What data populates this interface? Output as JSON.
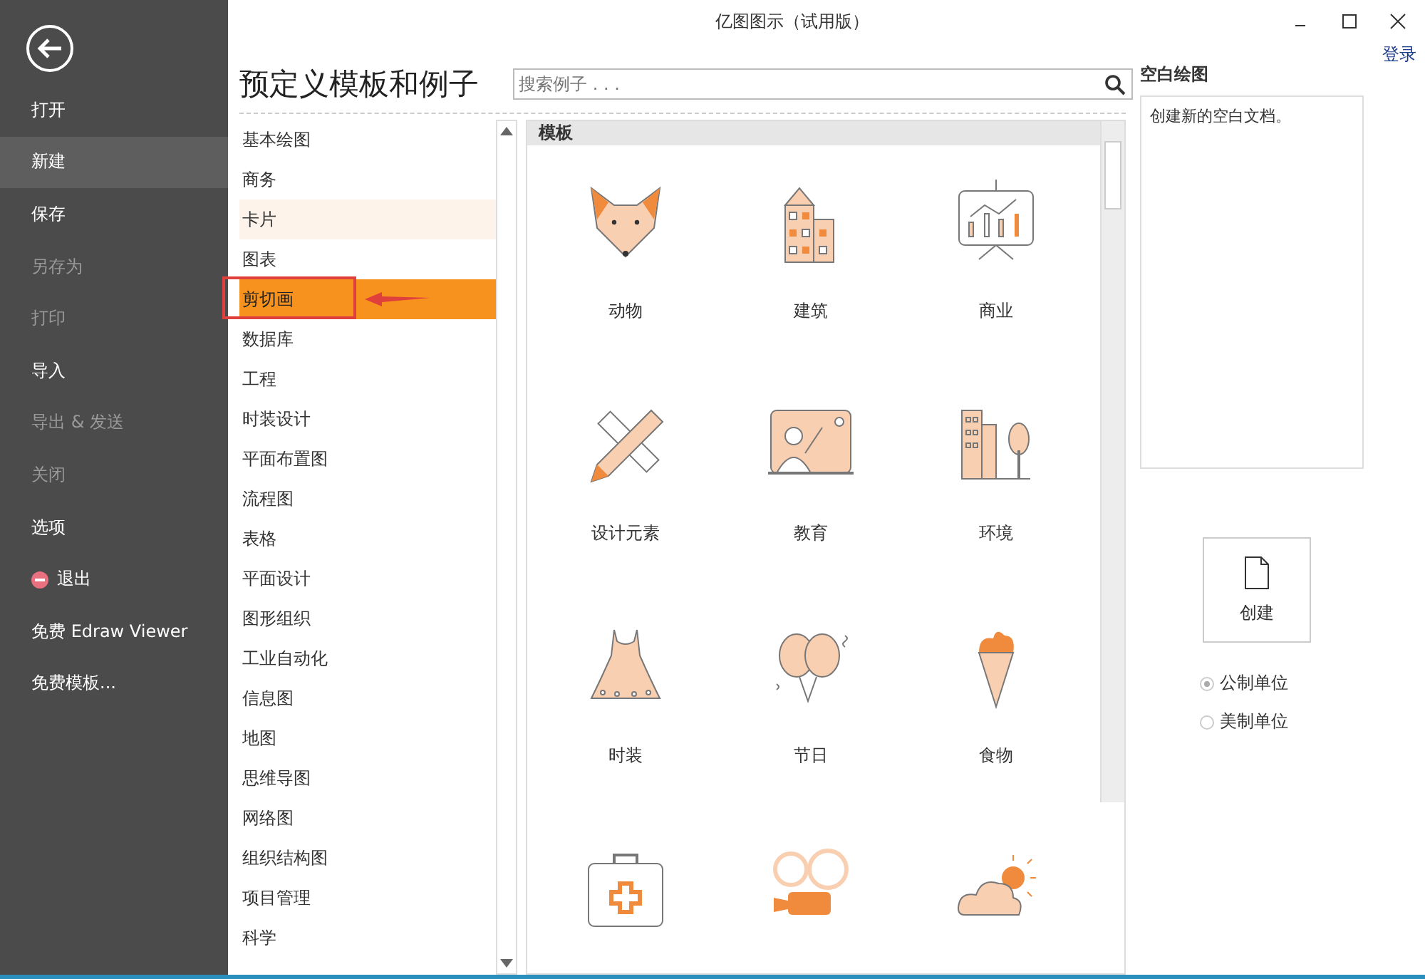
{
  "window": {
    "title": "亿图图示（试用版）",
    "login_link": "登录"
  },
  "sidebar": {
    "items": [
      {
        "label": "打开",
        "selected": false,
        "disabled": false,
        "kind": "text"
      },
      {
        "label": "新建",
        "selected": true,
        "disabled": false,
        "kind": "text"
      },
      {
        "label": "保存",
        "selected": false,
        "disabled": false,
        "kind": "text"
      },
      {
        "label": "另存为",
        "selected": false,
        "disabled": true,
        "kind": "text"
      },
      {
        "label": "打印",
        "selected": false,
        "disabled": true,
        "kind": "text"
      },
      {
        "label": "导入",
        "selected": false,
        "disabled": false,
        "kind": "text"
      },
      {
        "label": "导出 & 发送",
        "selected": false,
        "disabled": true,
        "kind": "text"
      },
      {
        "label": "关闭",
        "selected": false,
        "disabled": true,
        "kind": "text"
      },
      {
        "label": "选项",
        "selected": false,
        "disabled": false,
        "kind": "text"
      },
      {
        "label": "退出",
        "selected": false,
        "disabled": false,
        "kind": "exit"
      },
      {
        "label": "免费 Edraw Viewer",
        "selected": false,
        "disabled": false,
        "kind": "text"
      },
      {
        "label": "免费模板...",
        "selected": false,
        "disabled": false,
        "kind": "text"
      }
    ]
  },
  "heading": "预定义模板和例子",
  "search": {
    "placeholder": "搜索例子 . . ."
  },
  "categories": [
    {
      "label": "基本绘图",
      "selected": false,
      "hovered": false,
      "annotated": false
    },
    {
      "label": "商务",
      "selected": false,
      "hovered": false,
      "annotated": false
    },
    {
      "label": "卡片",
      "selected": false,
      "hovered": true,
      "annotated": false
    },
    {
      "label": "图表",
      "selected": false,
      "hovered": false,
      "annotated": false
    },
    {
      "label": "剪切画",
      "selected": true,
      "hovered": false,
      "annotated": true
    },
    {
      "label": "数据库",
      "selected": false,
      "hovered": false,
      "annotated": false
    },
    {
      "label": "工程",
      "selected": false,
      "hovered": false,
      "annotated": false
    },
    {
      "label": "时装设计",
      "selected": false,
      "hovered": false,
      "annotated": false
    },
    {
      "label": "平面布置图",
      "selected": false,
      "hovered": false,
      "annotated": false
    },
    {
      "label": "流程图",
      "selected": false,
      "hovered": false,
      "annotated": false
    },
    {
      "label": "表格",
      "selected": false,
      "hovered": false,
      "annotated": false
    },
    {
      "label": "平面设计",
      "selected": false,
      "hovered": false,
      "annotated": false
    },
    {
      "label": "图形组织",
      "selected": false,
      "hovered": false,
      "annotated": false
    },
    {
      "label": "工业自动化",
      "selected": false,
      "hovered": false,
      "annotated": false
    },
    {
      "label": "信息图",
      "selected": false,
      "hovered": false,
      "annotated": false
    },
    {
      "label": "地图",
      "selected": false,
      "hovered": false,
      "annotated": false
    },
    {
      "label": "思维导图",
      "selected": false,
      "hovered": false,
      "annotated": false
    },
    {
      "label": "网络图",
      "selected": false,
      "hovered": false,
      "annotated": false
    },
    {
      "label": "组织结构图",
      "selected": false,
      "hovered": false,
      "annotated": false
    },
    {
      "label": "项目管理",
      "selected": false,
      "hovered": false,
      "annotated": false
    },
    {
      "label": "科学",
      "selected": false,
      "hovered": false,
      "annotated": false
    }
  ],
  "templates": {
    "header": "模板",
    "items": [
      {
        "kind": "labeled",
        "label": "动物"
      },
      {
        "kind": "labeled",
        "label": "建筑"
      },
      {
        "kind": "labeled",
        "label": "商业"
      },
      {
        "kind": "labeled",
        "label": "设计元素"
      },
      {
        "kind": "labeled",
        "label": "教育"
      },
      {
        "kind": "labeled",
        "label": "环境"
      },
      {
        "kind": "labeled",
        "label": "时装"
      },
      {
        "kind": "labeled",
        "label": "节日"
      },
      {
        "kind": "labeled",
        "label": "食物"
      },
      {
        "kind": "icon_only"
      },
      {
        "kind": "icon_only"
      },
      {
        "kind": "icon_only"
      }
    ]
  },
  "preview": {
    "title": "空白绘图",
    "description": "创建新的空白文档。",
    "create_button": "创建"
  },
  "units": [
    {
      "label": "公制单位",
      "selected": true
    },
    {
      "label": "美制单位",
      "selected": false
    }
  ]
}
